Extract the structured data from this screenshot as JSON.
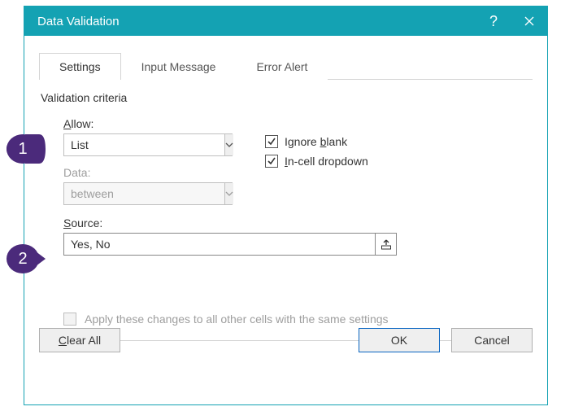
{
  "window": {
    "title": "Data Validation"
  },
  "tabs": {
    "settings": "Settings",
    "inputMessage": "Input Message",
    "errorAlert": "Error Alert"
  },
  "criteriaLabel": "Validation criteria",
  "allow": {
    "label_pre": "",
    "label_u": "A",
    "label_post": "llow:",
    "value": "List"
  },
  "dataField": {
    "label": "Data:",
    "value": "between"
  },
  "checks": {
    "ignoreBlank_pre": "Ignore ",
    "ignoreBlank_u": "b",
    "ignoreBlank_post": "lank",
    "inCell_pre": "",
    "inCell_u": "I",
    "inCell_post": "n-cell dropdown"
  },
  "source": {
    "label_u": "S",
    "label_post": "ource:",
    "value": "Yes, No"
  },
  "apply": {
    "label_pre": "Apply these changes to all other cells with the same settings"
  },
  "buttons": {
    "clearAll_u": "C",
    "clearAll_post": "lear All",
    "ok": "OK",
    "cancel": "Cancel"
  },
  "callouts": {
    "one": "1",
    "two": "2"
  }
}
